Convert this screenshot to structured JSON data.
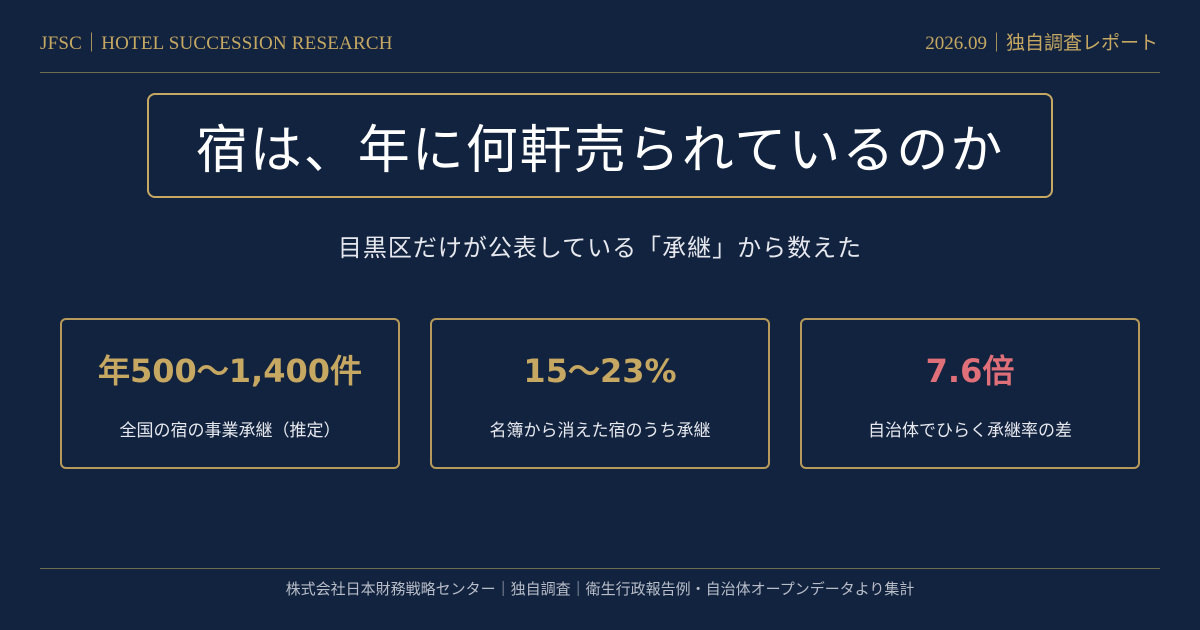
{
  "header": {
    "left": "JFSC｜HOTEL SUCCESSION RESEARCH",
    "right": "2026.09｜独自調査レポート"
  },
  "title": "宿は、年に何軒売られているのか",
  "subtitle": "目黒区だけが公表している「承継」から数えた",
  "stats": [
    {
      "value": "年500〜1,400件",
      "label": "全国の宿の事業承継（推定）"
    },
    {
      "value": "15〜23%",
      "label": "名簿から消えた宿のうち承継"
    },
    {
      "value": "7.6倍",
      "label": "自治体でひらく承継率の差"
    }
  ],
  "footer": "株式会社日本財務戦略センター｜独自調査｜衛生行政報告例・自治体オープンデータより集計",
  "colors": {
    "background": "#12233f",
    "accent": "#c7a862",
    "alert": "#df6f78",
    "text": "#e6e8ee"
  }
}
